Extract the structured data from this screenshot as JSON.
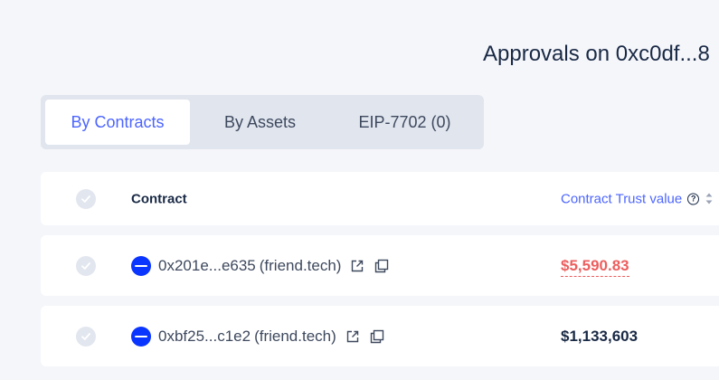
{
  "header": {
    "title": "Approvals on 0xc0df...8"
  },
  "tabs": [
    {
      "label": "By Contracts",
      "active": true
    },
    {
      "label": "By Assets",
      "active": false
    },
    {
      "label": "EIP-7702 (0)",
      "active": false
    }
  ],
  "table": {
    "columns": {
      "contract": "Contract",
      "trust_value": "Contract Trust value"
    },
    "rows": [
      {
        "address": "0x201e...e635",
        "protocol": "(friend.tech)",
        "trust_value": "$5,590.83",
        "trust_color": "#ec5e5e"
      },
      {
        "address": "0xbf25...c1e2",
        "protocol": "(friend.tech)",
        "trust_value": "$1,133,603",
        "trust_color": "#192945"
      }
    ]
  },
  "icons": {
    "help": "?",
    "token": "token-icon",
    "external": "external-link-icon",
    "copy": "copy-icon"
  },
  "colors": {
    "accent": "#4c65ff",
    "danger": "#ec5e5e",
    "text": "#192945",
    "token_blue": "#0a35ff"
  }
}
